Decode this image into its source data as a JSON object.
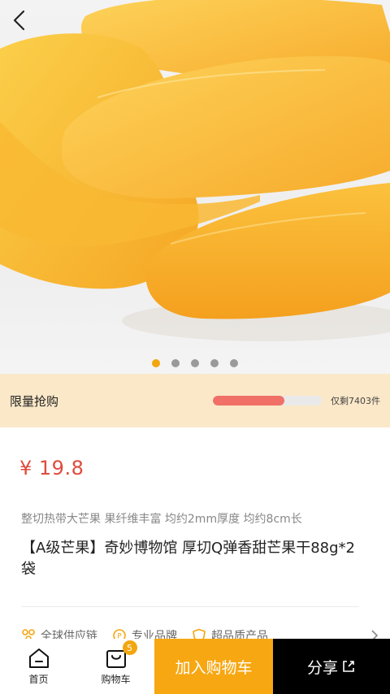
{
  "gallery": {
    "image_desc": "dried mango slices",
    "dot_count": 5,
    "active_index": 0
  },
  "flash_sale": {
    "label": "限量抢购",
    "progress_fraction": 0.66,
    "remaining_text": "仅剩7403件"
  },
  "product": {
    "price": "¥ 19.8",
    "subtitle": "整切热带大芒果 果纤维丰富 均约2mm厚度 均约8cm长",
    "title": "【A级芒果】奇妙博物馆 厚切Q弹香甜芒果干88g*2袋"
  },
  "features": [
    {
      "icon": "supply-chain-icon",
      "label": "全球供应链"
    },
    {
      "icon": "brand-icon",
      "label": "专业品牌"
    },
    {
      "icon": "shield-icon",
      "label": "超品质产品"
    }
  ],
  "bottom_bar": {
    "home_label": "首页",
    "cart_label": "购物车",
    "cart_badge": "5",
    "add_to_cart_label": "加入购物车",
    "share_label": "分享"
  },
  "colors": {
    "accent": "#f7a712",
    "price": "#e04a3c",
    "flash_bg": "#fbe8c8",
    "progress": "#f07068"
  }
}
